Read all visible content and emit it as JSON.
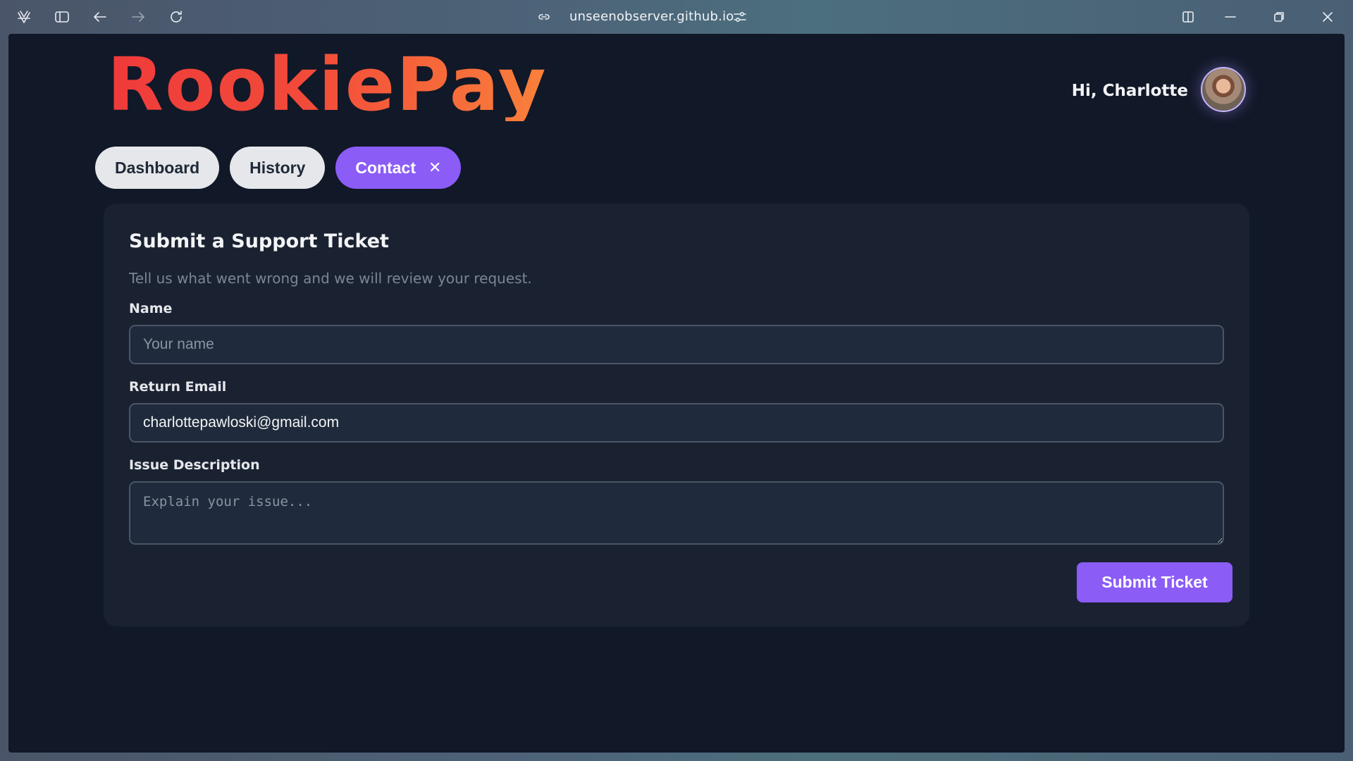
{
  "browser": {
    "url": "unseenobserver.github.io"
  },
  "header": {
    "logo_text": "RookiePay",
    "greeting": "Hi, Charlotte"
  },
  "tabs": [
    {
      "label": "Dashboard",
      "active": false
    },
    {
      "label": "History",
      "active": false
    },
    {
      "label": "Contact",
      "active": true,
      "close_glyph": "✕"
    }
  ],
  "form": {
    "title": "Submit a Support Ticket",
    "subtitle": "Tell us what went wrong and we will review your request.",
    "name_label": "Name",
    "name_placeholder": "Your name",
    "name_value": "",
    "email_label": "Return Email",
    "email_value": "charlottepawloski@gmail.com",
    "description_label": "Issue Description",
    "description_placeholder": "Explain your issue...",
    "submit_label": "Submit Ticket"
  },
  "colors": {
    "accent": "#8b5cf6",
    "page_bg": "#111827",
    "card_bg": "#1a2232",
    "logo_gradient_start": "#ef3b3b",
    "logo_gradient_end": "#f9813b"
  }
}
